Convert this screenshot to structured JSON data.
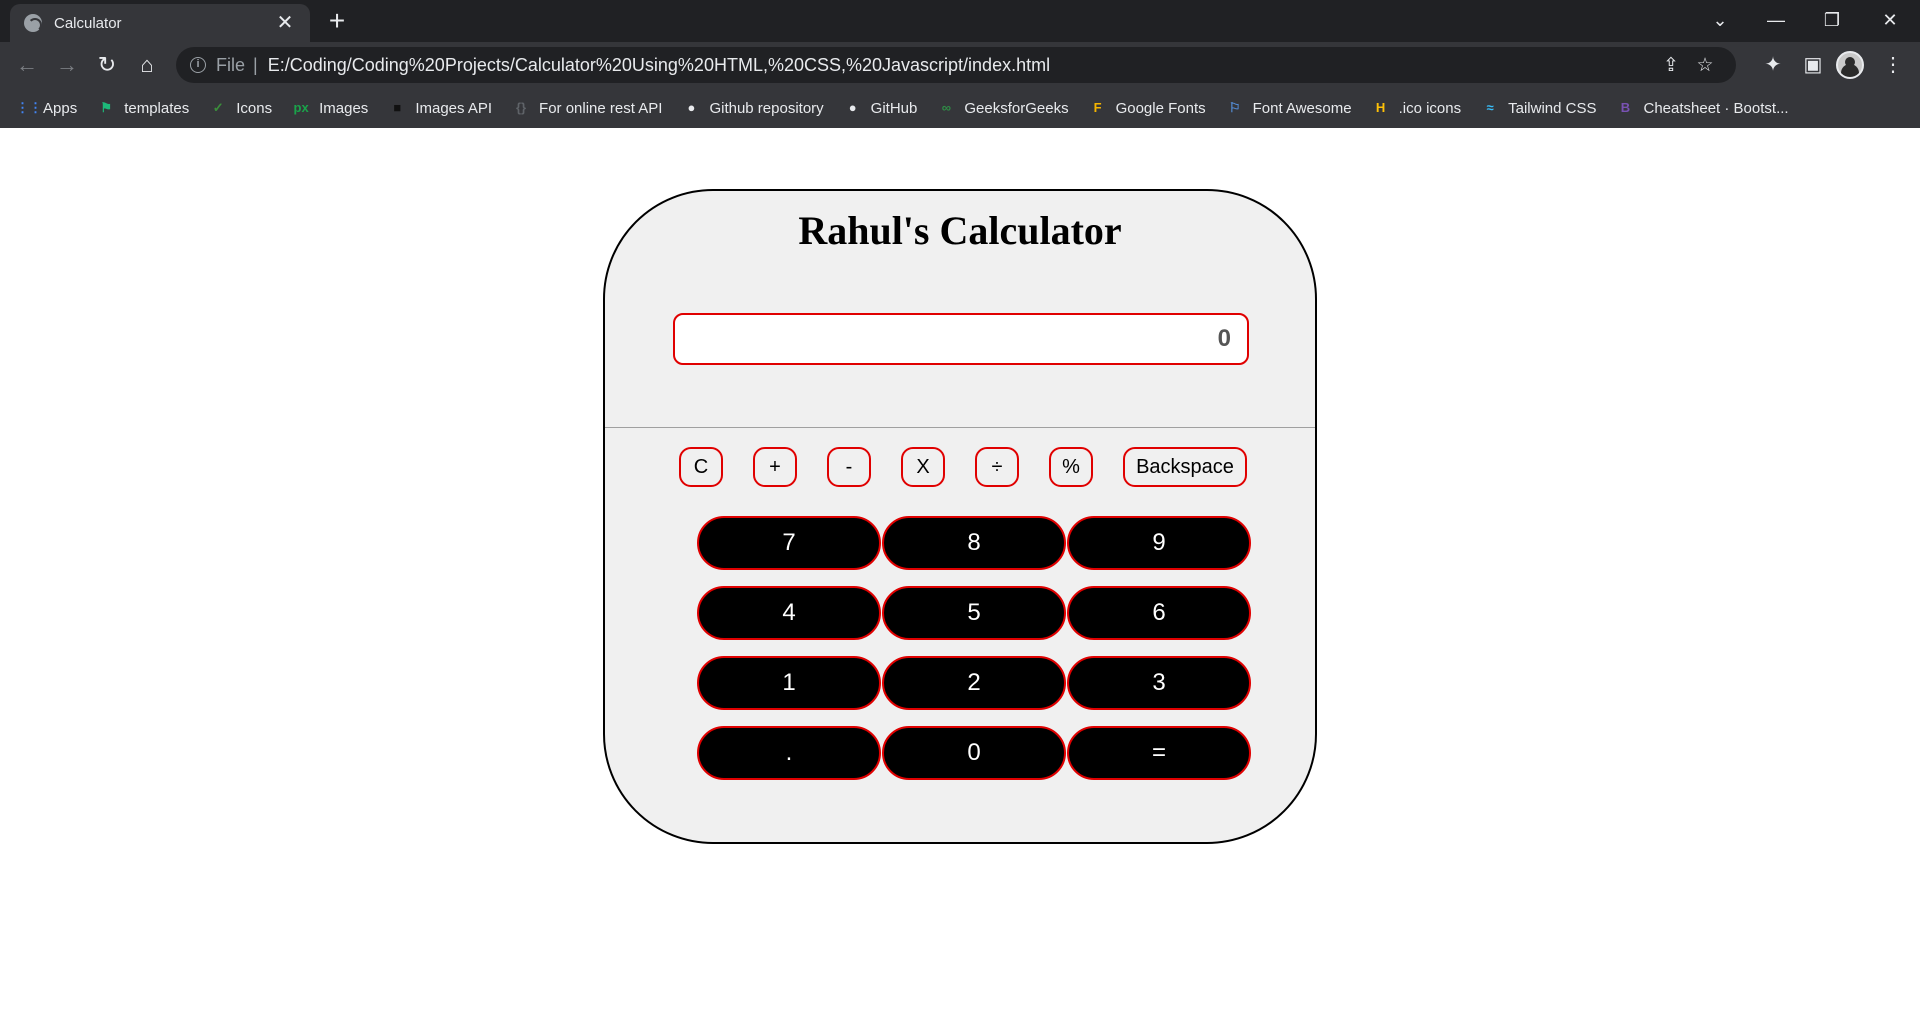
{
  "browser": {
    "tab_title": "Calculator",
    "tab_close": "✕",
    "new_tab": "+",
    "window_controls": {
      "tab_search": "⌄",
      "minimize": "—",
      "restore": "❐",
      "close": "✕"
    },
    "nav": {
      "back": "←",
      "forward": "→",
      "reload": "↻",
      "home": "⌂"
    },
    "address": {
      "scheme": "File",
      "separator": "|",
      "url": "E:/Coding/Coding%20Projects/Calculator%20Using%20HTML,%20CSS,%20Javascript/index.html",
      "info_glyph": "i",
      "share_glyph": "⇪",
      "star_glyph": "☆"
    },
    "extensions_glyph": "✦",
    "sidepanel_glyph": "▣",
    "menu_glyph": "⋮",
    "bookmarks": [
      {
        "label": "Apps",
        "icon": "apps-grid-icon",
        "glyph": "⋮⋮",
        "color": "#4285f4"
      },
      {
        "label": "templates",
        "icon": "templates-flag-icon",
        "glyph": "⚑",
        "color": "#1db97a"
      },
      {
        "label": "Icons",
        "icon": "icons-shield-icon",
        "glyph": "✓",
        "color": "#3b8f3b"
      },
      {
        "label": "Images",
        "icon": "px-logo-icon",
        "glyph": "px",
        "color": "#1aa34a"
      },
      {
        "label": "Images API",
        "icon": "unsplash-icon",
        "glyph": "■",
        "color": "#111111"
      },
      {
        "label": "For online rest API",
        "icon": "rest-api-icon",
        "glyph": "{}",
        "color": "#5f6368"
      },
      {
        "label": "Github repository",
        "icon": "github-icon",
        "glyph": "●",
        "color": "#e8eaed"
      },
      {
        "label": "GitHub",
        "icon": "github-icon",
        "glyph": "●",
        "color": "#e8eaed"
      },
      {
        "label": "GeeksforGeeks",
        "icon": "gfg-icon",
        "glyph": "∞",
        "color": "#2f8d46"
      },
      {
        "label": "Google Fonts",
        "icon": "google-fonts-icon",
        "glyph": "F",
        "color": "#f4b400"
      },
      {
        "label": "Font Awesome",
        "icon": "flag-icon",
        "glyph": "⚐",
        "color": "#538dd7"
      },
      {
        "label": ".ico icons",
        "icon": "ico-icon",
        "glyph": "H",
        "color": "#ffc107"
      },
      {
        "label": "Tailwind CSS",
        "icon": "tailwind-icon",
        "glyph": "≈",
        "color": "#38bdf8"
      },
      {
        "label": "Cheatsheet · Bootst...",
        "icon": "bootstrap-icon",
        "glyph": "B",
        "color": "#7952b3"
      }
    ]
  },
  "calculator": {
    "title": "Rahul's Calculator",
    "display_value": "0",
    "operators": [
      "C",
      "+",
      "-",
      "X",
      "÷",
      "%",
      "Backspace"
    ],
    "keys": [
      [
        "7",
        "8",
        "9"
      ],
      [
        "4",
        "5",
        "6"
      ],
      [
        "1",
        "2",
        "3"
      ],
      [
        ".",
        "0",
        "="
      ]
    ],
    "colors": {
      "accent_border": "#e00000",
      "key_bg": "#000000",
      "key_text": "#ffffff",
      "panel_bg": "#f0f0f0"
    }
  }
}
